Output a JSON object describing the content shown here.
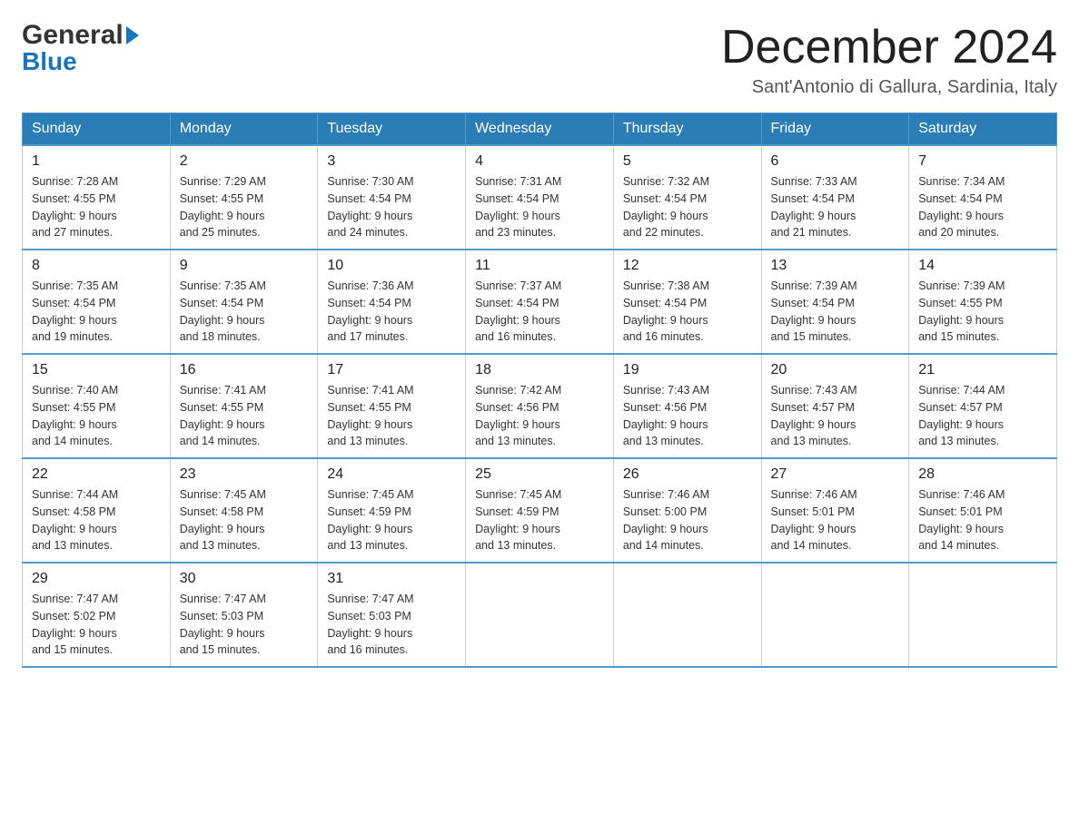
{
  "header": {
    "logo_general": "General",
    "logo_blue": "Blue",
    "month_title": "December 2024",
    "subtitle": "Sant'Antonio di Gallura, Sardinia, Italy"
  },
  "weekdays": [
    "Sunday",
    "Monday",
    "Tuesday",
    "Wednesday",
    "Thursday",
    "Friday",
    "Saturday"
  ],
  "weeks": [
    [
      {
        "day": "1",
        "sunrise": "7:28 AM",
        "sunset": "4:55 PM",
        "daylight": "9 hours and 27 minutes."
      },
      {
        "day": "2",
        "sunrise": "7:29 AM",
        "sunset": "4:55 PM",
        "daylight": "9 hours and 25 minutes."
      },
      {
        "day": "3",
        "sunrise": "7:30 AM",
        "sunset": "4:54 PM",
        "daylight": "9 hours and 24 minutes."
      },
      {
        "day": "4",
        "sunrise": "7:31 AM",
        "sunset": "4:54 PM",
        "daylight": "9 hours and 23 minutes."
      },
      {
        "day": "5",
        "sunrise": "7:32 AM",
        "sunset": "4:54 PM",
        "daylight": "9 hours and 22 minutes."
      },
      {
        "day": "6",
        "sunrise": "7:33 AM",
        "sunset": "4:54 PM",
        "daylight": "9 hours and 21 minutes."
      },
      {
        "day": "7",
        "sunrise": "7:34 AM",
        "sunset": "4:54 PM",
        "daylight": "9 hours and 20 minutes."
      }
    ],
    [
      {
        "day": "8",
        "sunrise": "7:35 AM",
        "sunset": "4:54 PM",
        "daylight": "9 hours and 19 minutes."
      },
      {
        "day": "9",
        "sunrise": "7:35 AM",
        "sunset": "4:54 PM",
        "daylight": "9 hours and 18 minutes."
      },
      {
        "day": "10",
        "sunrise": "7:36 AM",
        "sunset": "4:54 PM",
        "daylight": "9 hours and 17 minutes."
      },
      {
        "day": "11",
        "sunrise": "7:37 AM",
        "sunset": "4:54 PM",
        "daylight": "9 hours and 16 minutes."
      },
      {
        "day": "12",
        "sunrise": "7:38 AM",
        "sunset": "4:54 PM",
        "daylight": "9 hours and 16 minutes."
      },
      {
        "day": "13",
        "sunrise": "7:39 AM",
        "sunset": "4:54 PM",
        "daylight": "9 hours and 15 minutes."
      },
      {
        "day": "14",
        "sunrise": "7:39 AM",
        "sunset": "4:55 PM",
        "daylight": "9 hours and 15 minutes."
      }
    ],
    [
      {
        "day": "15",
        "sunrise": "7:40 AM",
        "sunset": "4:55 PM",
        "daylight": "9 hours and 14 minutes."
      },
      {
        "day": "16",
        "sunrise": "7:41 AM",
        "sunset": "4:55 PM",
        "daylight": "9 hours and 14 minutes."
      },
      {
        "day": "17",
        "sunrise": "7:41 AM",
        "sunset": "4:55 PM",
        "daylight": "9 hours and 13 minutes."
      },
      {
        "day": "18",
        "sunrise": "7:42 AM",
        "sunset": "4:56 PM",
        "daylight": "9 hours and 13 minutes."
      },
      {
        "day": "19",
        "sunrise": "7:43 AM",
        "sunset": "4:56 PM",
        "daylight": "9 hours and 13 minutes."
      },
      {
        "day": "20",
        "sunrise": "7:43 AM",
        "sunset": "4:57 PM",
        "daylight": "9 hours and 13 minutes."
      },
      {
        "day": "21",
        "sunrise": "7:44 AM",
        "sunset": "4:57 PM",
        "daylight": "9 hours and 13 minutes."
      }
    ],
    [
      {
        "day": "22",
        "sunrise": "7:44 AM",
        "sunset": "4:58 PM",
        "daylight": "9 hours and 13 minutes."
      },
      {
        "day": "23",
        "sunrise": "7:45 AM",
        "sunset": "4:58 PM",
        "daylight": "9 hours and 13 minutes."
      },
      {
        "day": "24",
        "sunrise": "7:45 AM",
        "sunset": "4:59 PM",
        "daylight": "9 hours and 13 minutes."
      },
      {
        "day": "25",
        "sunrise": "7:45 AM",
        "sunset": "4:59 PM",
        "daylight": "9 hours and 13 minutes."
      },
      {
        "day": "26",
        "sunrise": "7:46 AM",
        "sunset": "5:00 PM",
        "daylight": "9 hours and 14 minutes."
      },
      {
        "day": "27",
        "sunrise": "7:46 AM",
        "sunset": "5:01 PM",
        "daylight": "9 hours and 14 minutes."
      },
      {
        "day": "28",
        "sunrise": "7:46 AM",
        "sunset": "5:01 PM",
        "daylight": "9 hours and 14 minutes."
      }
    ],
    [
      {
        "day": "29",
        "sunrise": "7:47 AM",
        "sunset": "5:02 PM",
        "daylight": "9 hours and 15 minutes."
      },
      {
        "day": "30",
        "sunrise": "7:47 AM",
        "sunset": "5:03 PM",
        "daylight": "9 hours and 15 minutes."
      },
      {
        "day": "31",
        "sunrise": "7:47 AM",
        "sunset": "5:03 PM",
        "daylight": "9 hours and 16 minutes."
      },
      null,
      null,
      null,
      null
    ]
  ],
  "labels": {
    "sunrise": "Sunrise:",
    "sunset": "Sunset:",
    "daylight": "Daylight:"
  }
}
